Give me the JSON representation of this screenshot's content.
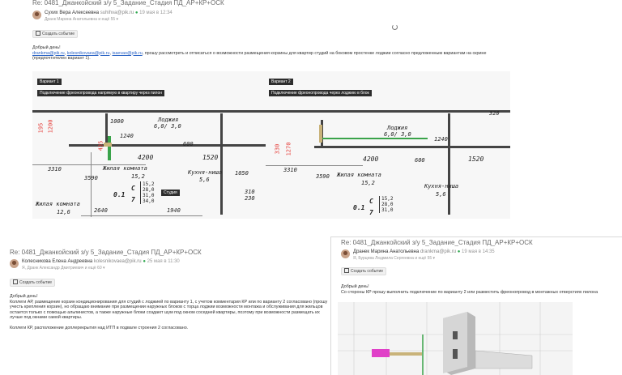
{
  "email1": {
    "subject": "Re: 0481_Джанкойский з/у 5_Задание_Стадия ПД_АР+КР+ОСК",
    "sender_name": "Сухих Вера Алексеевна",
    "sender_email": "suhihva@pik.ru",
    "date": "19 мая в 12:34",
    "recipients": "Дранк Марина Анатольевна и ещё 55 ▾",
    "event_btn": "Создать событие",
    "greeting": "Добрый день!",
    "link1": "drankma@pik.ru",
    "link2": "kolesnikovaea@pik.ru",
    "link3": "isaevao@pik.ru",
    "line1_rest": ", прошу рассмотреть и отписаться о возможности размещения корзины для квартир студий на боковом простенке лоджии согласно предложенным вариантам на скрине",
    "line2": "(предпочтителен вариант 1).",
    "variant1": {
      "label": "Вариант 1",
      "caption": "Подключение фреонопровода напрямую в квартиру через пилон"
    },
    "variant2": {
      "label": "Вариант 2",
      "caption": "Подключение фреонопровода через лоджию в блок"
    },
    "drawing": {
      "loggia": "Лоджия",
      "loggia_area": "6,0/ 3,0",
      "living": "Жилая комната",
      "living_area": "15,2",
      "kitchen": "Кухня-ниша",
      "kitchen_area": "5,6",
      "living2": "Жилая комната",
      "living2_area": "12,6",
      "studio": "Студия",
      "d3310": "3310",
      "d4200": "4200",
      "d1520": "1520",
      "d1240": "1240",
      "d1000": "1000",
      "d600": "600",
      "d3590": "3590",
      "d1050": "1050",
      "d2640": "2640",
      "d1940": "1940",
      "d310": "310",
      "d230": "230",
      "d320": "320",
      "r195": "195",
      "r1200": "1200",
      "r330": "330",
      "r435": "435",
      "r1270": "1270",
      "apt_no": "0.1",
      "apt_type": "С",
      "apt_rooms": "1",
      "apt_rooms_b": "7",
      "apt_vals": [
        "15,2",
        "28,0",
        "31,0",
        "34,0"
      ]
    }
  },
  "email2": {
    "subject": "Re: 0481_Джанкойский з/у 5_Задание_Стадия ПД_АР+КР+ОСК",
    "sender_name": "Колесникова Елена Андреевна",
    "sender_email": "kolesnikovaea@pik.ru",
    "date": "25 мая в 11:30",
    "recipients": "Я, Дранк Александр Дмитриевич и ещё 60 ▾",
    "event_btn": "Создать событие",
    "greeting": "Добрый день!",
    "para1": "Коллеги АР, размещение корзин кондиционирования для студий с лоджией по варианту 1, с учетом комментария КР или по варианту 2 согласовано (прошу учесть крепления корзин), но обращаю внимание при размещении наружных блоков с торца лоджии возможности монтажа и обслуживания для жильцов остается только с помощью альпинистов, а также наружные блоки создают шум под окном соседней квартиры, поэтому при возможности размещать их лучше под окнами самой квартиры.",
    "para2": "Коллеги КР, расположение доплерекрытия над ИТП в подвале строения 2 согласовано."
  },
  "email3": {
    "subject": "Re: 0481_Джанкойский з/у 5_Задание_Стадия ПД_АР+КР+ОСК",
    "sender_name": "Дранек Марина Анатольевна",
    "sender_email": "drankma@pik.ru",
    "date": "19 мая в 14:35",
    "recipients": "Я, Бурцева Людмила Сергеевна и ещё 55 ▾",
    "event_btn": "Создать событие",
    "greeting": "Добрый день!",
    "para1": "Со стороны КР прошу выполнить подключение по варианту 2 или разместить фреонопровод в монтажных отверстиях пилона"
  },
  "colors": {
    "link": "#2a63c6",
    "red_dim": "#e53935",
    "green_pipe": "#3aa34a",
    "magenta": "#e040c8",
    "tag_bg": "#2d2d2d"
  }
}
